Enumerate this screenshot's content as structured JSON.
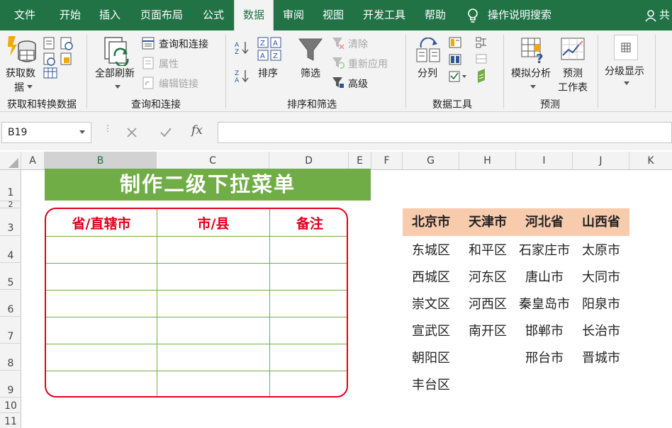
{
  "menu": {
    "tabs": [
      {
        "label": "文件"
      },
      {
        "label": "开始"
      },
      {
        "label": "插入"
      },
      {
        "label": "页面布局"
      },
      {
        "label": "公式"
      },
      {
        "label": "数据"
      },
      {
        "label": "审阅"
      },
      {
        "label": "视图"
      },
      {
        "label": "开发工具"
      },
      {
        "label": "帮助"
      }
    ],
    "search": "操作说明搜索",
    "share": "共"
  },
  "ribbon": {
    "get_data_l1": "获取数",
    "get_data_l2": "据",
    "group_get": "获取和转换数据",
    "refresh_all": "全部刷新",
    "query_conn": "查询和连接",
    "properties": "属性",
    "edit_links": "编辑链接",
    "group_query": "查询和连接",
    "sort": "排序",
    "filter": "筛选",
    "clear": "清除",
    "reapply": "重新应用",
    "advanced": "高级",
    "group_sort": "排序和筛选",
    "text_to_columns": "分列",
    "group_tools": "数据工具",
    "what_if": "模拟分析",
    "forecast_l1": "预测",
    "forecast_l2": "工作表",
    "group_forecast": "预测",
    "outline": "分级显示"
  },
  "formula_bar": {
    "name_box": "B19",
    "formula": ""
  },
  "columns": [
    "A",
    "B",
    "C",
    "D",
    "E",
    "F",
    "G",
    "H",
    "I",
    "J",
    "K"
  ],
  "rows": [
    "1",
    "2",
    "3",
    "4",
    "5",
    "6",
    "7",
    "8",
    "9",
    "10",
    "11"
  ],
  "sheet": {
    "title": "制作二级下拉菜单",
    "table_headers": [
      "省/直辖市",
      "市/县",
      "备注"
    ],
    "lookup_headers": [
      "北京市",
      "天津市",
      "河北省",
      "山西省"
    ],
    "lookup": {
      "beijing": [
        "东城区",
        "西城区",
        "崇文区",
        "宣武区",
        "朝阳区",
        "丰台区"
      ],
      "tianjin": [
        "和平区",
        "河东区",
        "河西区",
        "南开区"
      ],
      "hebei": [
        "石家庄市",
        "唐山市",
        "秦皇岛市",
        "邯郸市",
        "邢台市"
      ],
      "shanxi": [
        "太原市",
        "大同市",
        "阳泉市",
        "长治市",
        "晋城市"
      ]
    }
  },
  "colors": {
    "excel_green": "#217346",
    "title_fill": "#70ad47",
    "header_fill": "#f8cbad",
    "border_red": "#e0001b"
  }
}
